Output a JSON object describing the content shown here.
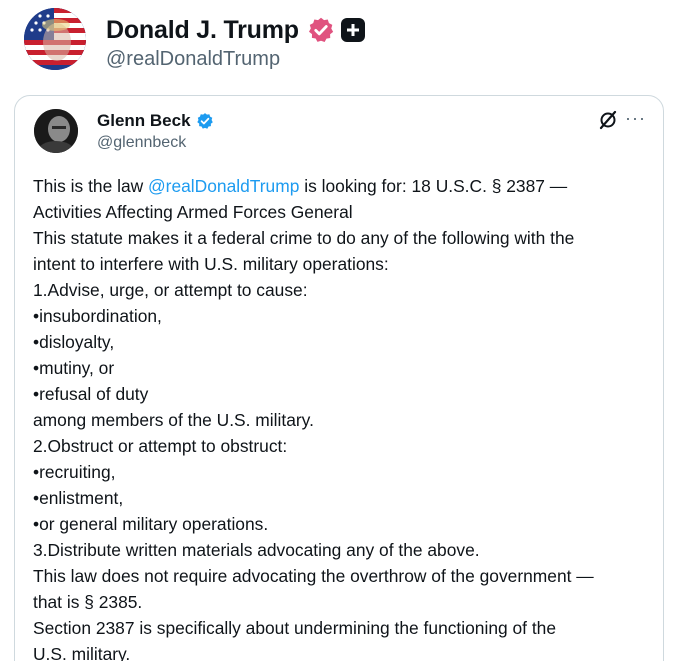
{
  "outer_post": {
    "display_name": "Donald J. Trump",
    "handle": "@realDonaldTrump"
  },
  "quoted_post": {
    "display_name": "Glenn Beck",
    "handle": "@glennbeck",
    "text": {
      "line1_prefix": "This is the law ",
      "line1_mention": "@realDonaldTrump",
      "line1_suffix": " is looking for:  18 U.S.C. § 2387 —",
      "lines": [
        "Activities Affecting Armed Forces General",
        "This statute makes it a federal crime to do any of the following with the",
        "intent to interfere with U.S. military operations:",
        "1.Advise, urge, or attempt to cause:",
        "•insubordination,",
        "•disloyalty,",
        "•mutiny, or",
        "•refusal of duty",
        "among members of the U.S. military.",
        "2.Obstruct or attempt to obstruct:",
        "•recruiting,",
        "•enlistment,",
        "•or general military operations.",
        "3.Distribute written materials advocating any of the above.",
        "This law does not require advocating the overthrow of the government —",
        "that is § 2385.",
        "Section 2387 is specifically about undermining the functioning of the",
        "U.S. military."
      ]
    }
  },
  "colors": {
    "accent_blue": "#1d9bf0",
    "badge_pink": "#e0527f",
    "text_primary": "#0f1419",
    "text_secondary": "#536471"
  },
  "icons": [
    "verified-badge-pink-icon",
    "plus-icon",
    "verified-badge-blue-icon",
    "grok-icon",
    "more-options-icon"
  ]
}
